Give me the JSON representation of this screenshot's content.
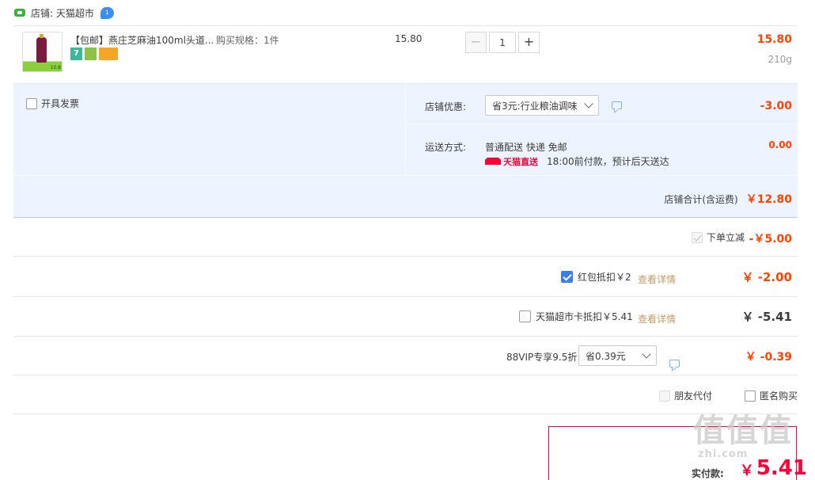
{
  "store": {
    "label": "店铺: 天猫超市",
    "ww_badge": "1"
  },
  "item": {
    "title": "【包邮】燕庄芝麻油100ml头道...",
    "thumb_tag": "10.8",
    "badges": [
      "7",
      "",
      ""
    ],
    "spec": "购买规格：1件",
    "unit_price": "15.80",
    "quantity": "1",
    "minus": "−",
    "plus": "+",
    "total": "15.80",
    "weight": "210g"
  },
  "invoice": {
    "label": "开具发票"
  },
  "store_discount": {
    "label": "店铺优惠:",
    "selected": "省3元:行业粮油调味",
    "amount": "-3.00"
  },
  "shipping": {
    "label": "运送方式:",
    "method": "普通配送 快递 免邮",
    "badge": "天猫直送",
    "note": "18:00前付款，预计后天送达",
    "amount": "0.00"
  },
  "store_total": {
    "label": "店铺合计(含运费)",
    "amount": "￥12.80"
  },
  "instant_discount": {
    "label": "下单立减",
    "amount": "-￥5.00"
  },
  "red_packet": {
    "label": "红包抵扣￥2",
    "link": "查看详情",
    "amount": "￥ -2.00"
  },
  "tmall_card": {
    "label": "天猫超市卡抵扣￥5.41",
    "link": "查看详情",
    "amount": "￥ -5.41"
  },
  "vip88": {
    "label": "88VIP专享9.5折",
    "selected": "省0.39元",
    "amount": "￥ -0.39"
  },
  "extras": {
    "friend_pay": "朋友代付",
    "anonymous": "匿名购买"
  },
  "final": {
    "label": "实付款:",
    "currency": "￥",
    "amount": "5.41",
    "hint": ""
  },
  "watermark": {
    "text": "值值值",
    "url": "zhi.com"
  },
  "colors": {
    "price_red": "#ff4400",
    "accent_blue": "#3d7ee5",
    "tmall_red": "#ff0036",
    "option_bg": "#eef4ff"
  }
}
